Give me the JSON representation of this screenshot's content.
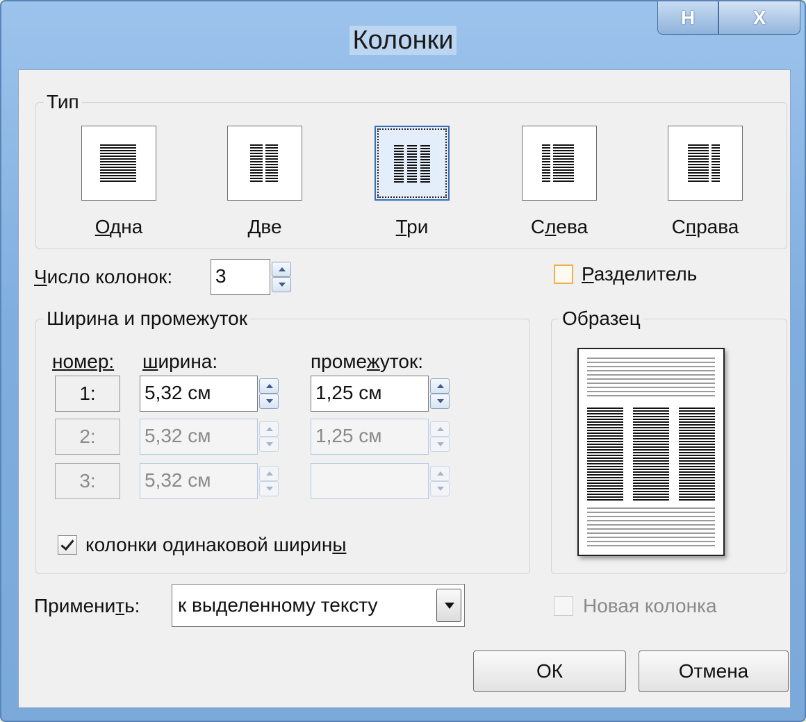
{
  "window": {
    "title": "Колонки",
    "help_glyph": "H",
    "close_glyph": "X"
  },
  "presets": {
    "group_label": "Тип",
    "items": [
      {
        "label": "Одна",
        "mnemonic_index": 0,
        "columns": 1
      },
      {
        "label": "Две",
        "mnemonic_index": 0,
        "columns": 2
      },
      {
        "label": "Три",
        "mnemonic_index": 0,
        "columns": 3,
        "selected": true
      },
      {
        "label": "Слева",
        "mnemonic_index": 1,
        "columns": "left"
      },
      {
        "label": "Справа",
        "mnemonic_index": 1,
        "columns": "right"
      }
    ]
  },
  "column_count": {
    "label_mn": "Ч",
    "label_rest": "исло колонок:",
    "value": "3"
  },
  "separator": {
    "label_mn": "Р",
    "label_rest": "азделитель",
    "checked": false
  },
  "width_spacing": {
    "group_label": "Ширина и промежуток",
    "header_number": "номер:",
    "header_width_mn": "ш",
    "header_width_rest": "ирина:",
    "header_spacing_a": "проме",
    "header_spacing_mn": "ж",
    "header_spacing_b": "уток:",
    "rows": [
      {
        "number": "1:",
        "width": "5,32 см",
        "spacing": "1,25 см",
        "enabled": true
      },
      {
        "number": "2:",
        "width": "5,32 см",
        "spacing": "1,25 см",
        "enabled": false
      },
      {
        "number": "3:",
        "width": "5,32 см",
        "spacing": "",
        "enabled": false
      }
    ],
    "equal_width": {
      "label_a": "колонки одинаковой ширин",
      "label_mn": "ы",
      "checked": true
    }
  },
  "preview": {
    "group_label": "Образец"
  },
  "apply": {
    "label_a": "Примени",
    "label_mn": "т",
    "label_b": "ь:",
    "value": "к выделенному тексту"
  },
  "new_column": {
    "label": "Новая колонка",
    "checked": false,
    "enabled": false
  },
  "buttons": {
    "ok": "ОК",
    "cancel": "Отмена"
  },
  "colors": {
    "frame": "#7faede",
    "selection": "#3b6db5",
    "separator_check_border": "#f0b050"
  }
}
